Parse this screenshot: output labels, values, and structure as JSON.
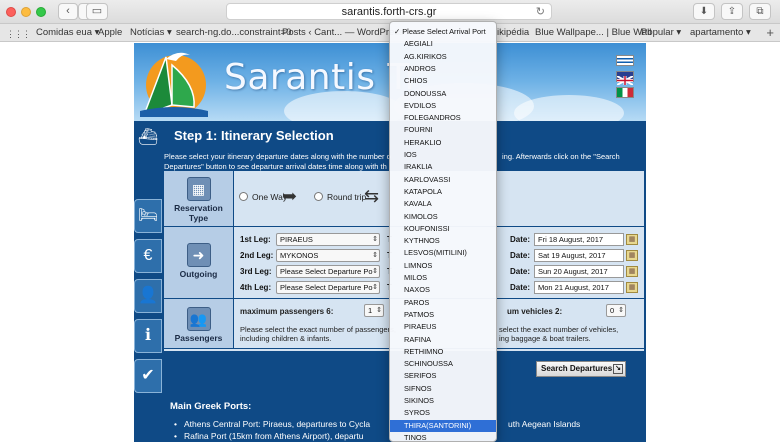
{
  "browser": {
    "url": "sarantis.forth-crs.gr",
    "bookmarks": [
      "Comidas eua ▾",
      "Apple",
      "Notícias ▾",
      "search-ng.do...constraint=0",
      "Posts ‹ Cant... — WordPress",
      "ikipédia",
      "Blue Wallpape... | Blue Wall",
      "Popular ▾",
      "apartamento ▾"
    ]
  },
  "header": {
    "site_title": "Sarantis Tr"
  },
  "step": {
    "title": "Step 1: Itinerary Selection",
    "intro_left": "Please select your itinerary departure dates along with the number o",
    "intro_right": "ing. Afterwards click on the \"Search",
    "intro_line2": "Departures\" button to see departure arrival dates time along with th"
  },
  "reservation": {
    "label_line1": "Reservation",
    "label_line2": "Type",
    "one_way": "One Way",
    "round_trip": "Round trip"
  },
  "outgoing": {
    "label": "Outgoing",
    "legs": [
      {
        "label": "1st Leg:",
        "from": "PIRAEUS",
        "to_label": "T",
        "date_label": "Date:",
        "date": "Fri 18 August, 2017"
      },
      {
        "label": "2nd Leg:",
        "from": "MYKONOS",
        "to_label": "T",
        "date_label": "Date:",
        "date": "Sat 19 August, 2017"
      },
      {
        "label": "3rd Leg:",
        "from": "Please Select Departure Po",
        "to_label": "T",
        "date_label": "Date:",
        "date": "Sun 20 August, 2017"
      },
      {
        "label": "4th Leg:",
        "from": "Please Select Departure Po",
        "to_label": "T",
        "date_label": "Date:",
        "date": "Mon 21 August, 2017"
      }
    ]
  },
  "passengers": {
    "label": "Passengers",
    "max_label": "maximum passengers 6:",
    "count": "1",
    "vehicles_label": "um vehicles 2:",
    "vehicles_count": "0",
    "note_left_1": "Please select the exact number of passengers,",
    "note_left_2": "including children & infants.",
    "note_right_1": "select the exact number of vehicles,",
    "note_right_2": "ing baggage & boat trailers."
  },
  "search_button": "Search Departures",
  "ports": {
    "title": "Main Greek Ports:",
    "items": [
      {
        "left": "Athens Central Port: Piraeus, departures to Cycla",
        "right": "uth Aegean Islands"
      },
      {
        "left": "Rafina Port (15km from Athens Airport), departu",
        "right": ""
      }
    ]
  },
  "dropdown": {
    "items": [
      "Please Select Arrival Port",
      "AEGIALI",
      "AG.KIRIKOS",
      "ANDROS",
      "CHIOS",
      "DONOUSSA",
      "EVDILOS",
      "FOLEGANDROS",
      "FOURNI",
      "HERAKLIO",
      "IOS",
      "IRAKLIA",
      "KARLOVASSI",
      "KATAPOLA",
      "KAVALA",
      "KIMOLOS",
      "KOUFONISSI",
      "KYTHNOS",
      "LESVOS(MITILINI)",
      "LIMNOS",
      "MILOS",
      "NAXOS",
      "PAROS",
      "PATMOS",
      "PIRAEUS",
      "RAFINA",
      "RETHIMNO",
      "SCHINOUSSA",
      "SERIFOS",
      "SIFNOS",
      "SIKINOS",
      "SYROS",
      "THIRA(SANTORINI)",
      "TINOS"
    ],
    "checked_index": 0,
    "highlighted_index": 32
  }
}
